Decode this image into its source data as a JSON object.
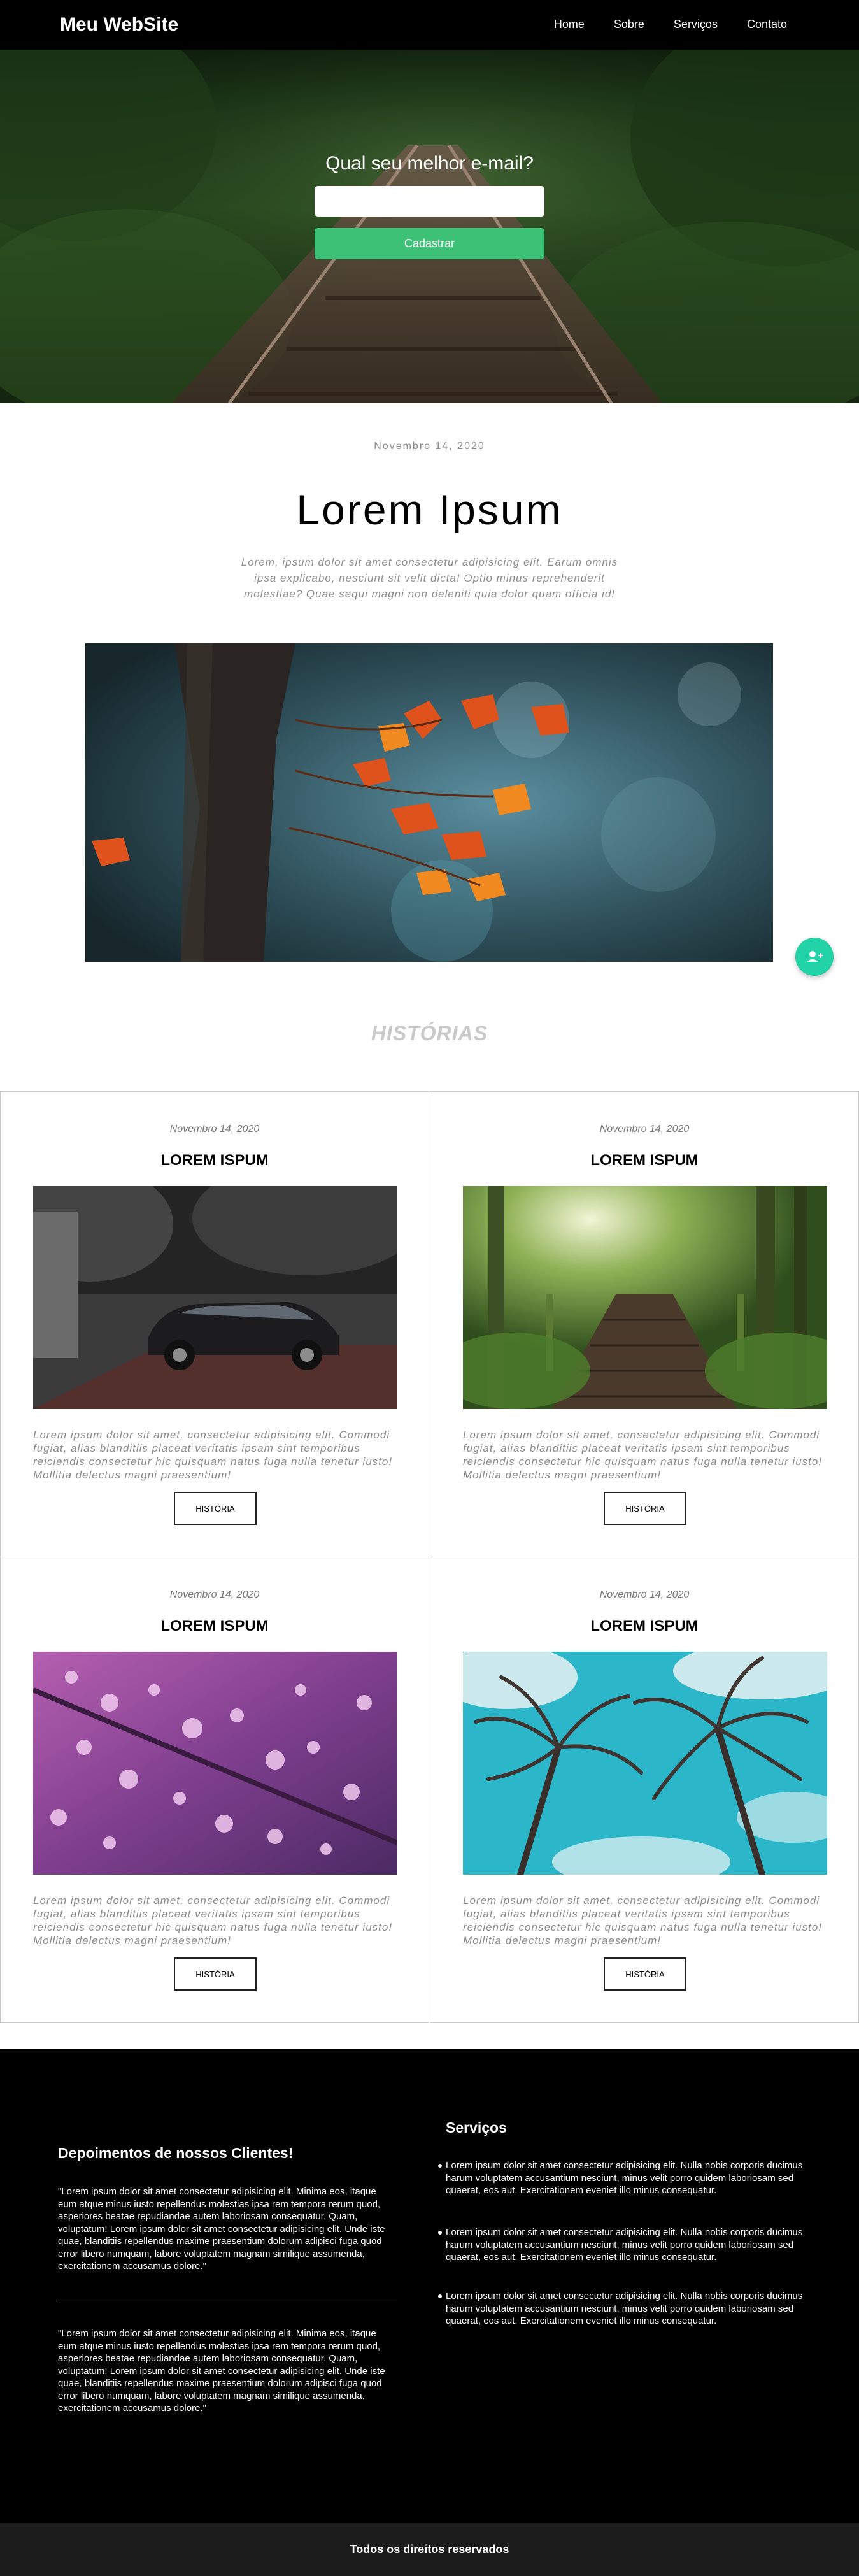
{
  "header": {
    "logo": "Meu WebSite",
    "nav": [
      "Home",
      "Sobre",
      "Serviços",
      "Contato"
    ]
  },
  "hero": {
    "title": "Qual seu melhor e-mail?",
    "email_value": "",
    "button_label": "Cadastrar"
  },
  "post": {
    "date": "Novembro 14, 2020",
    "title": "Lorem Ipsum",
    "excerpt": "Lorem, ipsum dolor sit amet consectetur adipisicing elit. Earum omnis ipsa explicabo, nesciunt sit velit dicta! Optio minus reprehenderit molestiae? Quae sequi magni non deleniti quia dolor quam officia id!"
  },
  "fab": {
    "icon": "add-user-icon"
  },
  "stories": {
    "heading": "HISTÓRIAS",
    "cards": [
      {
        "date": "Novembro 14, 2020",
        "title": "LOREM ISPUM",
        "image": "car-garden-photo",
        "text": "Lorem ipsum dolor sit amet, consectetur adipisicing elit. Commodi fugiat, alias blanditiis placeat veritatis ipsam sint temporibus reiciendis consectetur hic quisquam natus fuga nulla tenetur iusto! Mollitia delectus magni praesentium!",
        "button": "HISTÓRIA"
      },
      {
        "date": "Novembro 14, 2020",
        "title": "LOREM ISPUM",
        "image": "forest-bridge-photo",
        "text": "Lorem ipsum dolor sit amet, consectetur adipisicing elit. Commodi fugiat, alias blanditiis placeat veritatis ipsam sint temporibus reiciendis consectetur hic quisquam natus fuga nulla tenetur iusto! Mollitia delectus magni praesentium!",
        "button": "HISTÓRIA"
      },
      {
        "date": "Novembro 14, 2020",
        "title": "LOREM ISPUM",
        "image": "water-drops-leaf-photo",
        "text": "Lorem ipsum dolor sit amet, consectetur adipisicing elit. Commodi fugiat, alias blanditiis placeat veritatis ipsam sint temporibus reiciendis consectetur hic quisquam natus fuga nulla tenetur iusto! Mollitia delectus magni praesentium!",
        "button": "HISTÓRIA"
      },
      {
        "date": "Novembro 14, 2020",
        "title": "LOREM ISPUM",
        "image": "palm-trees-sky-photo",
        "text": "Lorem ipsum dolor sit amet, consectetur adipisicing elit. Commodi fugiat, alias blanditiis placeat veritatis ipsam sint temporibus reiciendis consectetur hic quisquam natus fuga nulla tenetur iusto! Mollitia delectus magni praesentium!",
        "button": "HISTÓRIA"
      }
    ]
  },
  "footer": {
    "testimonials_heading": "Depoimentos de nossos Clientes!",
    "testimonials": [
      "\"Lorem ipsum dolor sit amet consectetur adipisicing elit. Minima eos, itaque eum atque minus iusto repellendus molestias ipsa rem tempora rerum quod, asperiores beatae repudiandae autem laboriosam consequatur. Quam, voluptatum! Lorem ipsum dolor sit amet consectetur adipisicing elit. Unde iste quae, blanditiis repellendus maxime praesentium dolorum adipisci fuga quod error libero numquam, labore voluptatem magnam similique assumenda, exercitationem accusamus dolore.\"",
      "\"Lorem ipsum dolor sit amet consectetur adipisicing elit. Minima eos, itaque eum atque minus iusto repellendus molestias ipsa rem tempora rerum quod, asperiores beatae repudiandae autem laboriosam consequatur. Quam, voluptatum! Lorem ipsum dolor sit amet consectetur adipisicing elit. Unde iste quae, blanditiis repellendus maxime praesentium dolorum adipisci fuga quod error libero numquam, labore voluptatem magnam similique assumenda, exercitationem accusamus dolore.\""
    ],
    "services_heading": "Serviços",
    "services": [
      "Lorem ipsum dolor sit amet consectetur adipisicing elit. Nulla nobis corporis ducimus harum voluptatem accusantium nesciunt, minus velit porro quidem laboriosam sed quaerat, eos aut. Exercitationem eveniet illo minus consequatur.",
      "Lorem ipsum dolor sit amet consectetur adipisicing elit. Nulla nobis corporis ducimus harum voluptatem accusantium nesciunt, minus velit porro quidem laboriosam sed quaerat, eos aut. Exercitationem eveniet illo minus consequatur.",
      "Lorem ipsum dolor sit amet consectetur adipisicing elit. Nulla nobis corporis ducimus harum voluptatem accusantium nesciunt, minus velit porro quidem laboriosam sed quaerat, eos aut. Exercitationem eveniet illo minus consequatur."
    ],
    "copyright": "Todos os direitos reservados"
  },
  "colors": {
    "accent_green": "#3cc177",
    "fab_teal": "#21d3a6",
    "header_bg": "#000000",
    "footer_bg": "#000000",
    "bottom_bar_bg": "#1c1c1c"
  }
}
